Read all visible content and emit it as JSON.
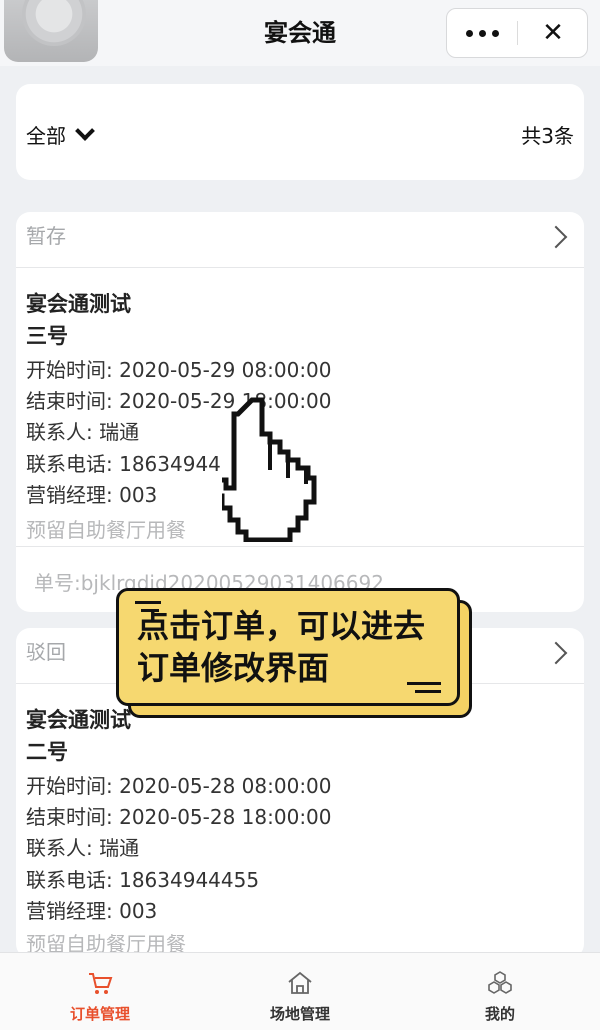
{
  "header": {
    "title": "宴会通",
    "close_glyph": "✕"
  },
  "filter": {
    "selected": "全部",
    "count": "共3条"
  },
  "orders": [
    {
      "status": "暂存",
      "name_line1": "宴会通测试",
      "name_line2": "三号",
      "start": "开始时间: 2020-05-29 08:00:00",
      "end": "结束时间: 2020-05-29 18:00:00",
      "contact": "联系人: 瑞通",
      "phone": "联系电话: 18634944",
      "manager": "营销经理: 003",
      "note": "预留自助餐厅用餐",
      "order_no": "单号:bjklrqdid20200529031406692"
    },
    {
      "status": "驳回",
      "name_line1": "宴会通测试",
      "name_line2": "二号",
      "start": "开始时间: 2020-05-28 08:00:00",
      "end": "结束时间: 2020-05-28 18:00:00",
      "contact": "联系人: 瑞通",
      "phone": "联系电话: 18634944455",
      "manager": "营销经理: 003",
      "note": "预留自助餐厅用餐"
    }
  ],
  "tip": {
    "text": "点击订单，可以进去订单修改界面"
  },
  "tabbar": {
    "tabs": [
      {
        "label": "订单管理",
        "icon": "cart-icon",
        "active": true
      },
      {
        "label": "场地管理",
        "icon": "house-icon",
        "active": false
      },
      {
        "label": "我的",
        "icon": "cubes-icon",
        "active": false
      }
    ]
  },
  "colors": {
    "accent": "#e8502c",
    "tip_bg": "#f6d870",
    "page_bg": "#eef0f3"
  }
}
